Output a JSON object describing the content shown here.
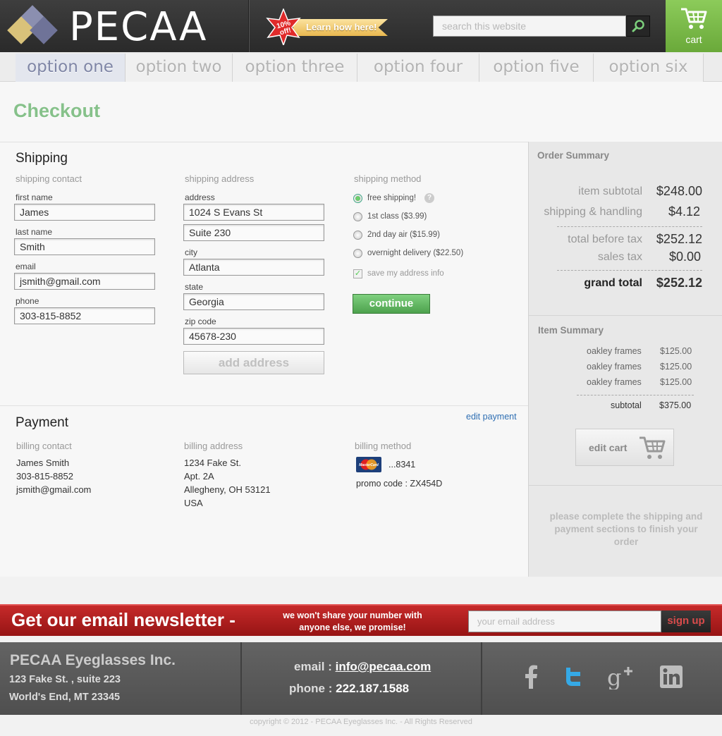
{
  "brand": {
    "name": "PECAA"
  },
  "promo": {
    "badge_line1": "10%",
    "badge_line2": "off!",
    "ribbon": "Learn how here!"
  },
  "search": {
    "placeholder": "search this website"
  },
  "cart": {
    "label": "cart"
  },
  "nav": {
    "tabs": [
      {
        "label": "option one"
      },
      {
        "label": "option two"
      },
      {
        "label": "option three"
      },
      {
        "label": "option four"
      },
      {
        "label": "option five"
      },
      {
        "label": "option six"
      }
    ]
  },
  "page": {
    "title": "Checkout"
  },
  "shipping": {
    "title": "Shipping",
    "contact_label": "shipping contact",
    "address_label": "shipping address",
    "method_label": "shipping method",
    "first_name_label": "first name",
    "first_name": "James",
    "last_name_label": "last name",
    "last_name": "Smith",
    "email_label": "email",
    "email": "jsmith@gmail.com",
    "phone_label": "phone",
    "phone": "303-815-8852",
    "street_label": "address",
    "street1": "1024 S Evans St",
    "street2": "Suite 230",
    "city_label": "city",
    "city": "Atlanta",
    "state_label": "state",
    "state": "Georgia",
    "zip_label": "zip code",
    "zip": "45678-230",
    "add_address": "add address",
    "methods": [
      {
        "label": "free shipping!",
        "selected": true
      },
      {
        "label": "1st class ($3.99)",
        "selected": false
      },
      {
        "label": "2nd day air ($15.99)",
        "selected": false
      },
      {
        "label": "overnight delivery ($22.50)",
        "selected": false
      }
    ],
    "help": "?",
    "save_info": "save my address info",
    "continue": "continue"
  },
  "payment": {
    "title": "Payment",
    "edit": "edit payment",
    "contact_label": "billing contact",
    "address_label": "billing address",
    "method_label": "billing method",
    "contact": [
      "James Smith",
      "303-815-8852",
      "jsmith@gmail.com"
    ],
    "address": [
      "1234 Fake St.",
      "Apt. 2A",
      "Allegheny, OH 53121",
      "USA"
    ],
    "card_brand": "MasterCard",
    "card_last": "...8341",
    "promo_code": "promo code : ZX454D"
  },
  "order_summary": {
    "title": "Order Summary",
    "rows": [
      {
        "label": "item subtotal",
        "value": "$248.00"
      },
      {
        "label": "shipping & handling",
        "value": "$4.12"
      },
      {
        "label": "total before tax",
        "value": "$252.12"
      },
      {
        "label": "sales tax",
        "value": "$0.00"
      },
      {
        "label": "grand total",
        "value": "$252.12"
      }
    ]
  },
  "item_summary": {
    "title": "Item Summary",
    "items": [
      {
        "name": "oakley frames",
        "price": "$125.00"
      },
      {
        "name": "oakley frames",
        "price": "$125.00"
      },
      {
        "name": "oakley frames",
        "price": "$125.00"
      }
    ],
    "subtotal_label": "subtotal",
    "subtotal": "$375.00",
    "edit_cart": "edit cart"
  },
  "note": "please complete the shipping and payment sections to finish your order",
  "newsletter": {
    "title": "Get our email newsletter -",
    "subtitle": "we won't share your number with anyone else, we promise!",
    "placeholder": "your email address",
    "button": "sign up"
  },
  "footer": {
    "company": "PECAA Eyeglasses Inc.",
    "address1": "123 Fake St. , suite 223",
    "address2": "World's End, MT 23345",
    "email_label": "email :",
    "email": "info@pecaa.com",
    "phone_label": "phone :",
    "phone": "222.187.1588",
    "copyright": "copyright © 2012 - PECAA Eyeglasses Inc. - All Rights Reserved"
  },
  "social": [
    "facebook-icon",
    "twitter-icon",
    "google-plus-icon",
    "linkedin-icon"
  ],
  "colors": {
    "accent_green": "#86c18a",
    "newsletter_red": "#b21f1f",
    "link_blue": "#2f6fb3"
  }
}
